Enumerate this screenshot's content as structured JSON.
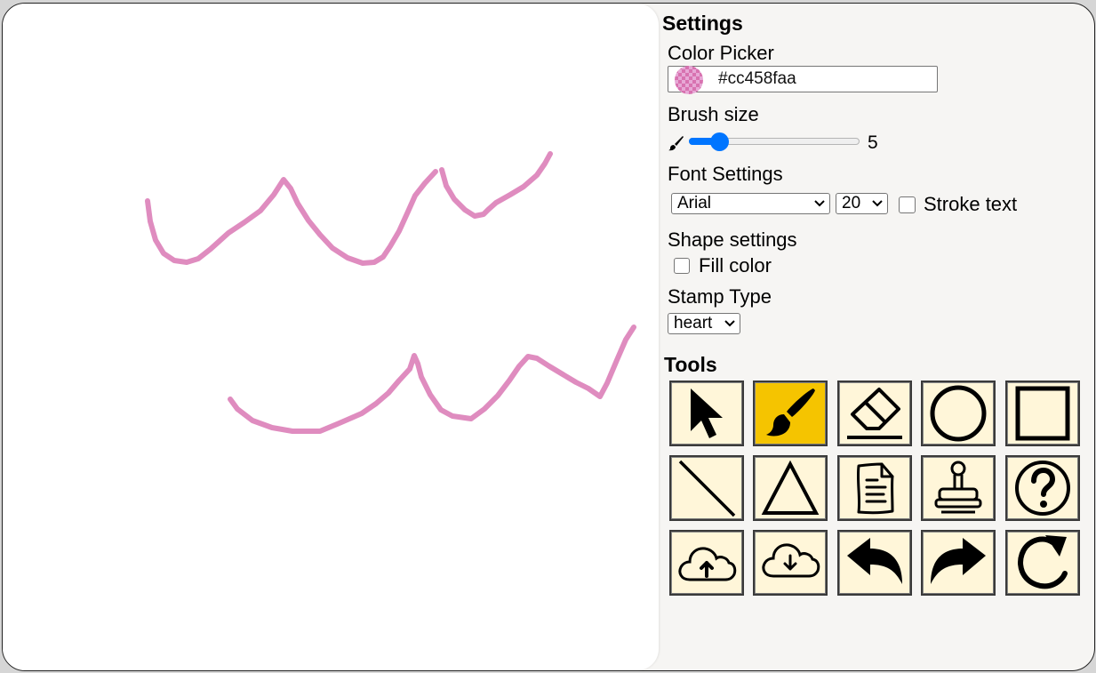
{
  "settings": {
    "title": "Settings",
    "color_picker": {
      "label": "Color Picker",
      "value": "#cc458faa",
      "swatch_color": "#cc458f"
    },
    "brush_size": {
      "label": "Brush size",
      "value": "5",
      "fraction": 0.08
    },
    "font_settings": {
      "label": "Font Settings",
      "font_family": "Arial",
      "font_size": "20",
      "stroke_text_label": "Stroke text",
      "stroke_text_checked": false
    },
    "shape_settings": {
      "label": "Shape settings",
      "fill_color_label": "Fill color",
      "fill_color_checked": false
    },
    "stamp": {
      "label": "Stamp Type",
      "value": "heart"
    }
  },
  "tools": {
    "title": "Tools",
    "active_color": "#f5c400",
    "items": [
      {
        "name": "select-tool",
        "icon": "cursor-icon"
      },
      {
        "name": "brush-tool",
        "icon": "paintbrush-icon",
        "active": true
      },
      {
        "name": "eraser-tool",
        "icon": "eraser-icon"
      },
      {
        "name": "circle-tool",
        "icon": "circle-icon"
      },
      {
        "name": "rectangle-tool",
        "icon": "square-icon"
      },
      {
        "name": "line-tool",
        "icon": "line-icon"
      },
      {
        "name": "triangle-tool",
        "icon": "triangle-icon"
      },
      {
        "name": "text-tool",
        "icon": "document-icon"
      },
      {
        "name": "stamp-tool",
        "icon": "stamp-icon"
      },
      {
        "name": "help-tool",
        "icon": "question-icon"
      },
      {
        "name": "upload-tool",
        "icon": "cloud-upload-icon"
      },
      {
        "name": "download-tool",
        "icon": "cloud-download-icon"
      },
      {
        "name": "undo-tool",
        "icon": "undo-icon"
      },
      {
        "name": "redo-tool",
        "icon": "redo-icon"
      },
      {
        "name": "clear-tool",
        "icon": "reload-icon"
      }
    ]
  },
  "canvas": {
    "stroke_color": "#df8cbf"
  }
}
